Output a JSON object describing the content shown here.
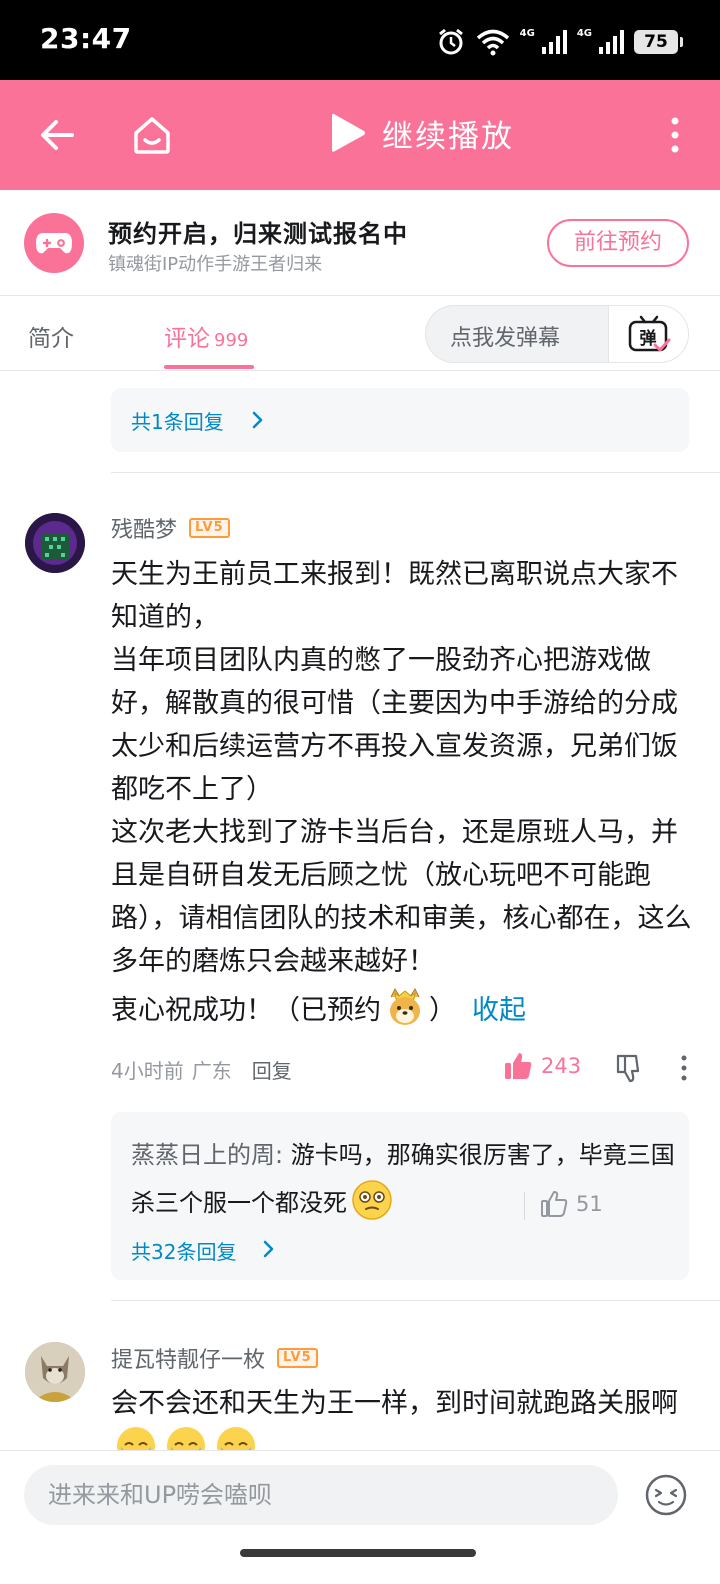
{
  "status_bar": {
    "time": "23:47",
    "network_1": "4G",
    "network_2": "4G",
    "battery": "75"
  },
  "nav": {
    "play_label": "继续播放"
  },
  "promo": {
    "title": "预约开启，归来测试报名中",
    "subtitle": "镇魂街IP动作手游王者归来",
    "button": "前往预约"
  },
  "tabs": {
    "intro": "简介",
    "comments": "评论",
    "comments_count": "999",
    "danmaku_placeholder": "点我发弹幕",
    "danmaku_button_glyph": "弹"
  },
  "top_reply_box": {
    "link": "共1条回复"
  },
  "comment1": {
    "username": "残酷梦",
    "level": "LV5",
    "lines": [
      "天生为王前员工来报到！既然已离职说点大家不知道的，",
      "当年项目团队内真的憋了一股劲齐心把游戏做好，解散真的很可惜（主要因为中手游给的分成太少和后续运营方不再投入宣发资源，兄弟们饭都吃不上了）",
      "这次老大找到了游卡当后台，还是原班人马，并且是自研自发无后顾之忧（放心玩吧不可能跑路），请相信团队的技术和审美，核心都在，这么多年的磨炼只会越来越好！"
    ],
    "last_line_start": "衷心祝成功！（已预约",
    "last_line_end": "）",
    "collapse": "收起",
    "time": "4小时前",
    "location": "广东",
    "reply": "回复",
    "likes": "243",
    "sub_reply": {
      "author": "蒸蒸日上的周",
      "text": "游卡吗，那确实很厉害了，毕竟三国杀三个服一个都没死",
      "likes": "51",
      "more": "共32条回复"
    }
  },
  "comment2": {
    "username": "提瓦特靓仔一枚",
    "level": "LV5",
    "text": "会不会还和天生为王一样，到时间就跑路关服啊"
  },
  "bottom": {
    "input_placeholder": "进来来和UP唠会嗑呗"
  }
}
